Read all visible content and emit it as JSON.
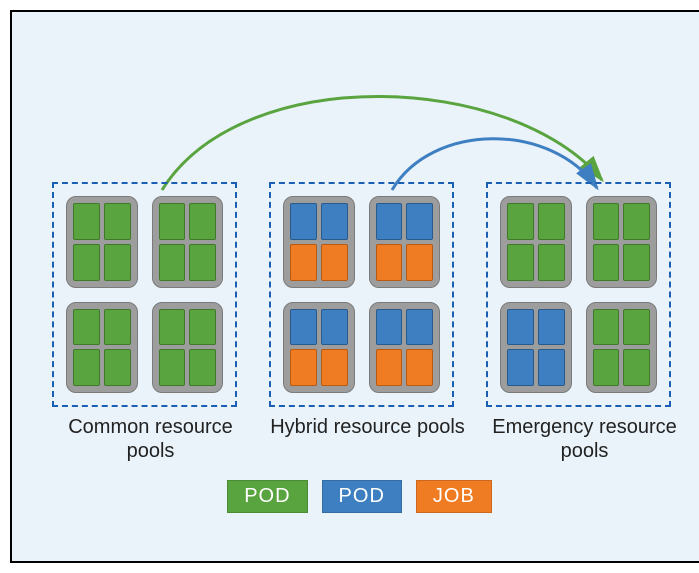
{
  "diagram": {
    "pools": [
      {
        "name": "Common resource pools",
        "nodes": [
          [
            "green",
            "green",
            "green",
            "green"
          ],
          [
            "green",
            "green",
            "green",
            "green"
          ],
          [
            "green",
            "green",
            "green",
            "green"
          ],
          [
            "green",
            "green",
            "green",
            "green"
          ]
        ]
      },
      {
        "name": "Hybrid resource pools",
        "nodes": [
          [
            "blue",
            "blue",
            "orange",
            "orange"
          ],
          [
            "blue",
            "blue",
            "orange",
            "orange"
          ],
          [
            "blue",
            "blue",
            "orange",
            "orange"
          ],
          [
            "blue",
            "blue",
            "orange",
            "orange"
          ]
        ]
      },
      {
        "name": "Emergency resource pools",
        "nodes": [
          [
            "green",
            "green",
            "green",
            "green"
          ],
          [
            "green",
            "green",
            "green",
            "green"
          ],
          [
            "blue",
            "blue",
            "blue",
            "blue"
          ],
          [
            "green",
            "green",
            "green",
            "green"
          ]
        ]
      }
    ],
    "labels": {
      "pool1": "Common resource pools",
      "pool2": "Hybrid resource pools",
      "pool3": "Emergency resource pools"
    },
    "legend": {
      "pod_green": "POD",
      "pod_blue": "POD",
      "job_orange": "JOB"
    },
    "arrows": [
      {
        "from": "common",
        "to": "emergency",
        "color": "#5aa43f"
      },
      {
        "from": "hybrid",
        "to": "emergency",
        "color": "#3e7fc1"
      }
    ],
    "colors": {
      "green": "#5aa43f",
      "blue": "#3e7fc1",
      "orange": "#ef7b23",
      "background": "#eaf3fa",
      "dashed_border": "#1a5fb4"
    }
  }
}
